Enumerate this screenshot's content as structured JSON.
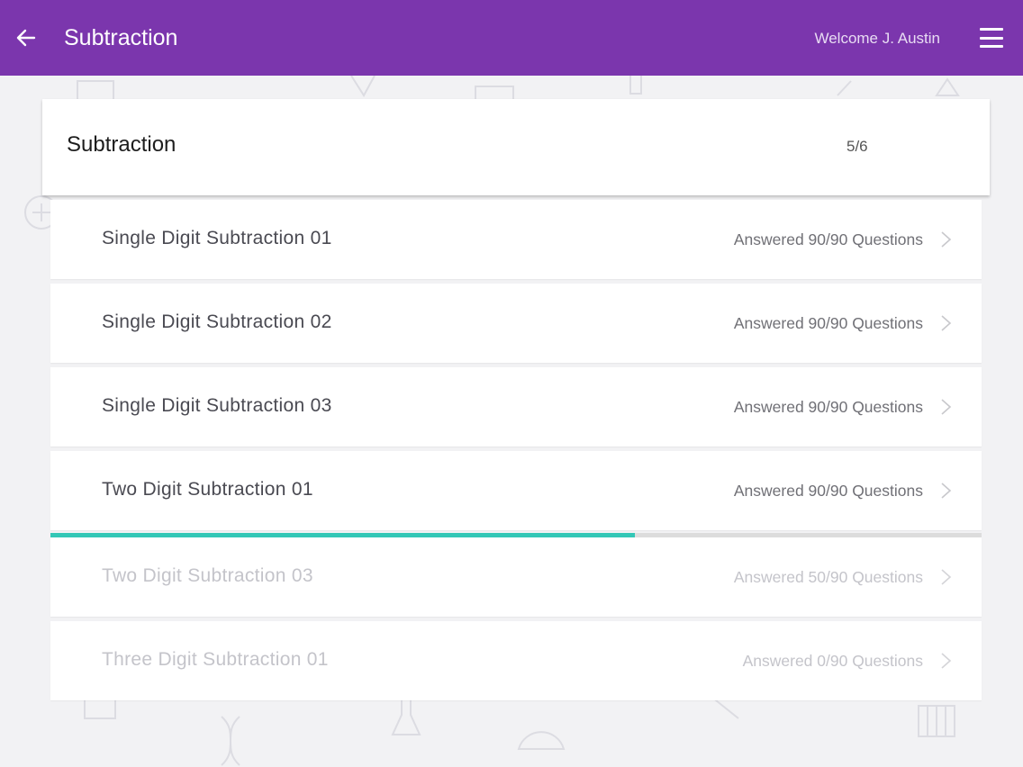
{
  "header": {
    "title": "Subtraction",
    "welcome": "Welcome J. Austin",
    "back_icon": "arrow-left-icon",
    "menu_icon": "hamburger-menu-icon"
  },
  "course": {
    "title": "Subtraction",
    "progress": "5/6"
  },
  "lessons": [
    {
      "title": "Single Digit Subtraction 01",
      "status": "Answered 90/90 Questions",
      "state": "complete"
    },
    {
      "title": "Single Digit Subtraction 02",
      "status": "Answered 90/90 Questions",
      "state": "complete"
    },
    {
      "title": "Single Digit Subtraction 03",
      "status": "Answered 90/90 Questions",
      "state": "complete"
    },
    {
      "title": "Two Digit Subtraction 01",
      "status": "Answered 90/90 Questions",
      "state": "complete"
    },
    {
      "title": "Two Digit Subtraction 03",
      "status": "Answered 50/90 Questions",
      "state": "locked"
    },
    {
      "title": "Three Digit Subtraction 01",
      "status": "Answered 0/90 Questions",
      "state": "locked"
    }
  ],
  "current_progress": {
    "fraction": 0.628,
    "color": "#33c7b6"
  },
  "colors": {
    "topbar": "#7b36ad",
    "background": "#f2f2f4"
  }
}
